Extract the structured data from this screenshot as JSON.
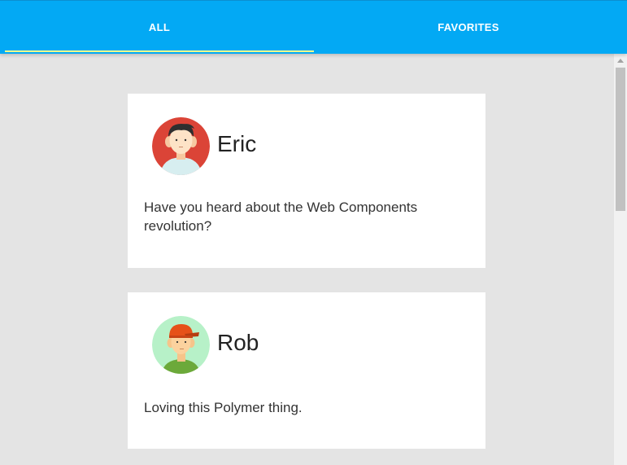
{
  "tabs": [
    {
      "label": "ALL",
      "selected": true
    },
    {
      "label": "FAVORITES",
      "selected": false
    }
  ],
  "posts": [
    {
      "name": "Eric",
      "message": "Have you heard about the Web Components revolution?",
      "avatar": "eric-avatar-icon"
    },
    {
      "name": "Rob",
      "message": "Loving this Polymer thing.",
      "avatar": "rob-avatar-icon"
    }
  ],
  "colors": {
    "accent": "#03a9f4",
    "indicator": "#ffff8d",
    "background": "#e4e4e4",
    "card": "#ffffff"
  }
}
